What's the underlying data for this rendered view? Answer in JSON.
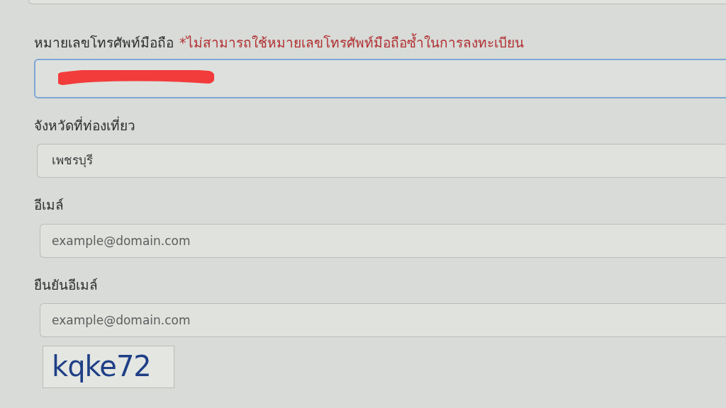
{
  "phone": {
    "label": "หมายเลขโทรศัพท์มือถือ",
    "note": "*ไม่สามารถใช้หมายเลขโทรศัพท์มือถือซ้ำในการลงทะเบียน",
    "focused": true,
    "redacted": true
  },
  "fields": [
    {
      "kind": "select",
      "label": "จังหวัดที่ท่องเที่ยว",
      "value": "เพชรบุรี"
    },
    {
      "kind": "input",
      "label": "อีเมล์",
      "placeholder": "example@domain.com"
    },
    {
      "kind": "input",
      "label": "ยืนยันอีเมล์",
      "placeholder": "example@domain.com"
    }
  ],
  "captcha": {
    "text": "kqke72"
  }
}
